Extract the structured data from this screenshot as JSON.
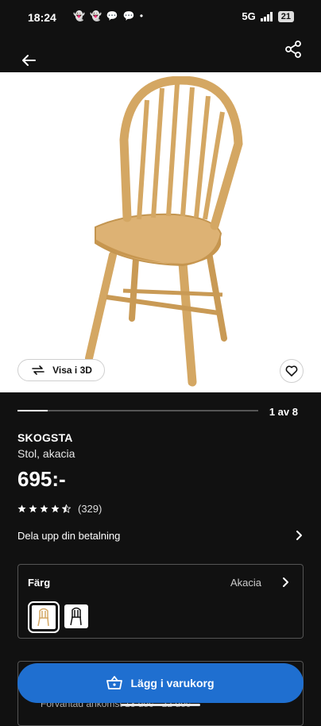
{
  "status_bar": {
    "time": "18:24",
    "network": "5G",
    "battery": "21"
  },
  "gallery": {
    "counter": "1 av 8",
    "progress": 0.125
  },
  "view3d_label": "Visa i 3D",
  "product": {
    "name": "SKOGSTA",
    "description": "Stol, akacia",
    "price": "695:-",
    "review_count": "(329)",
    "rating": 4.5
  },
  "payment_label": "Dela upp din betalning",
  "color": {
    "label": "Färg",
    "value": "Akacia"
  },
  "delivery_text": "Förväntad ankomst 13 dec - 22 dec",
  "cart_button_label": "Lägg i varukorg",
  "icons": [
    "back-arrow-icon",
    "share-icon",
    "rotate-3d-icon",
    "heart-icon",
    "star-icon",
    "chevron-right-icon",
    "cart-icon"
  ],
  "colors": {
    "background": "#111111",
    "accent_blue": "#1f6fd0"
  }
}
